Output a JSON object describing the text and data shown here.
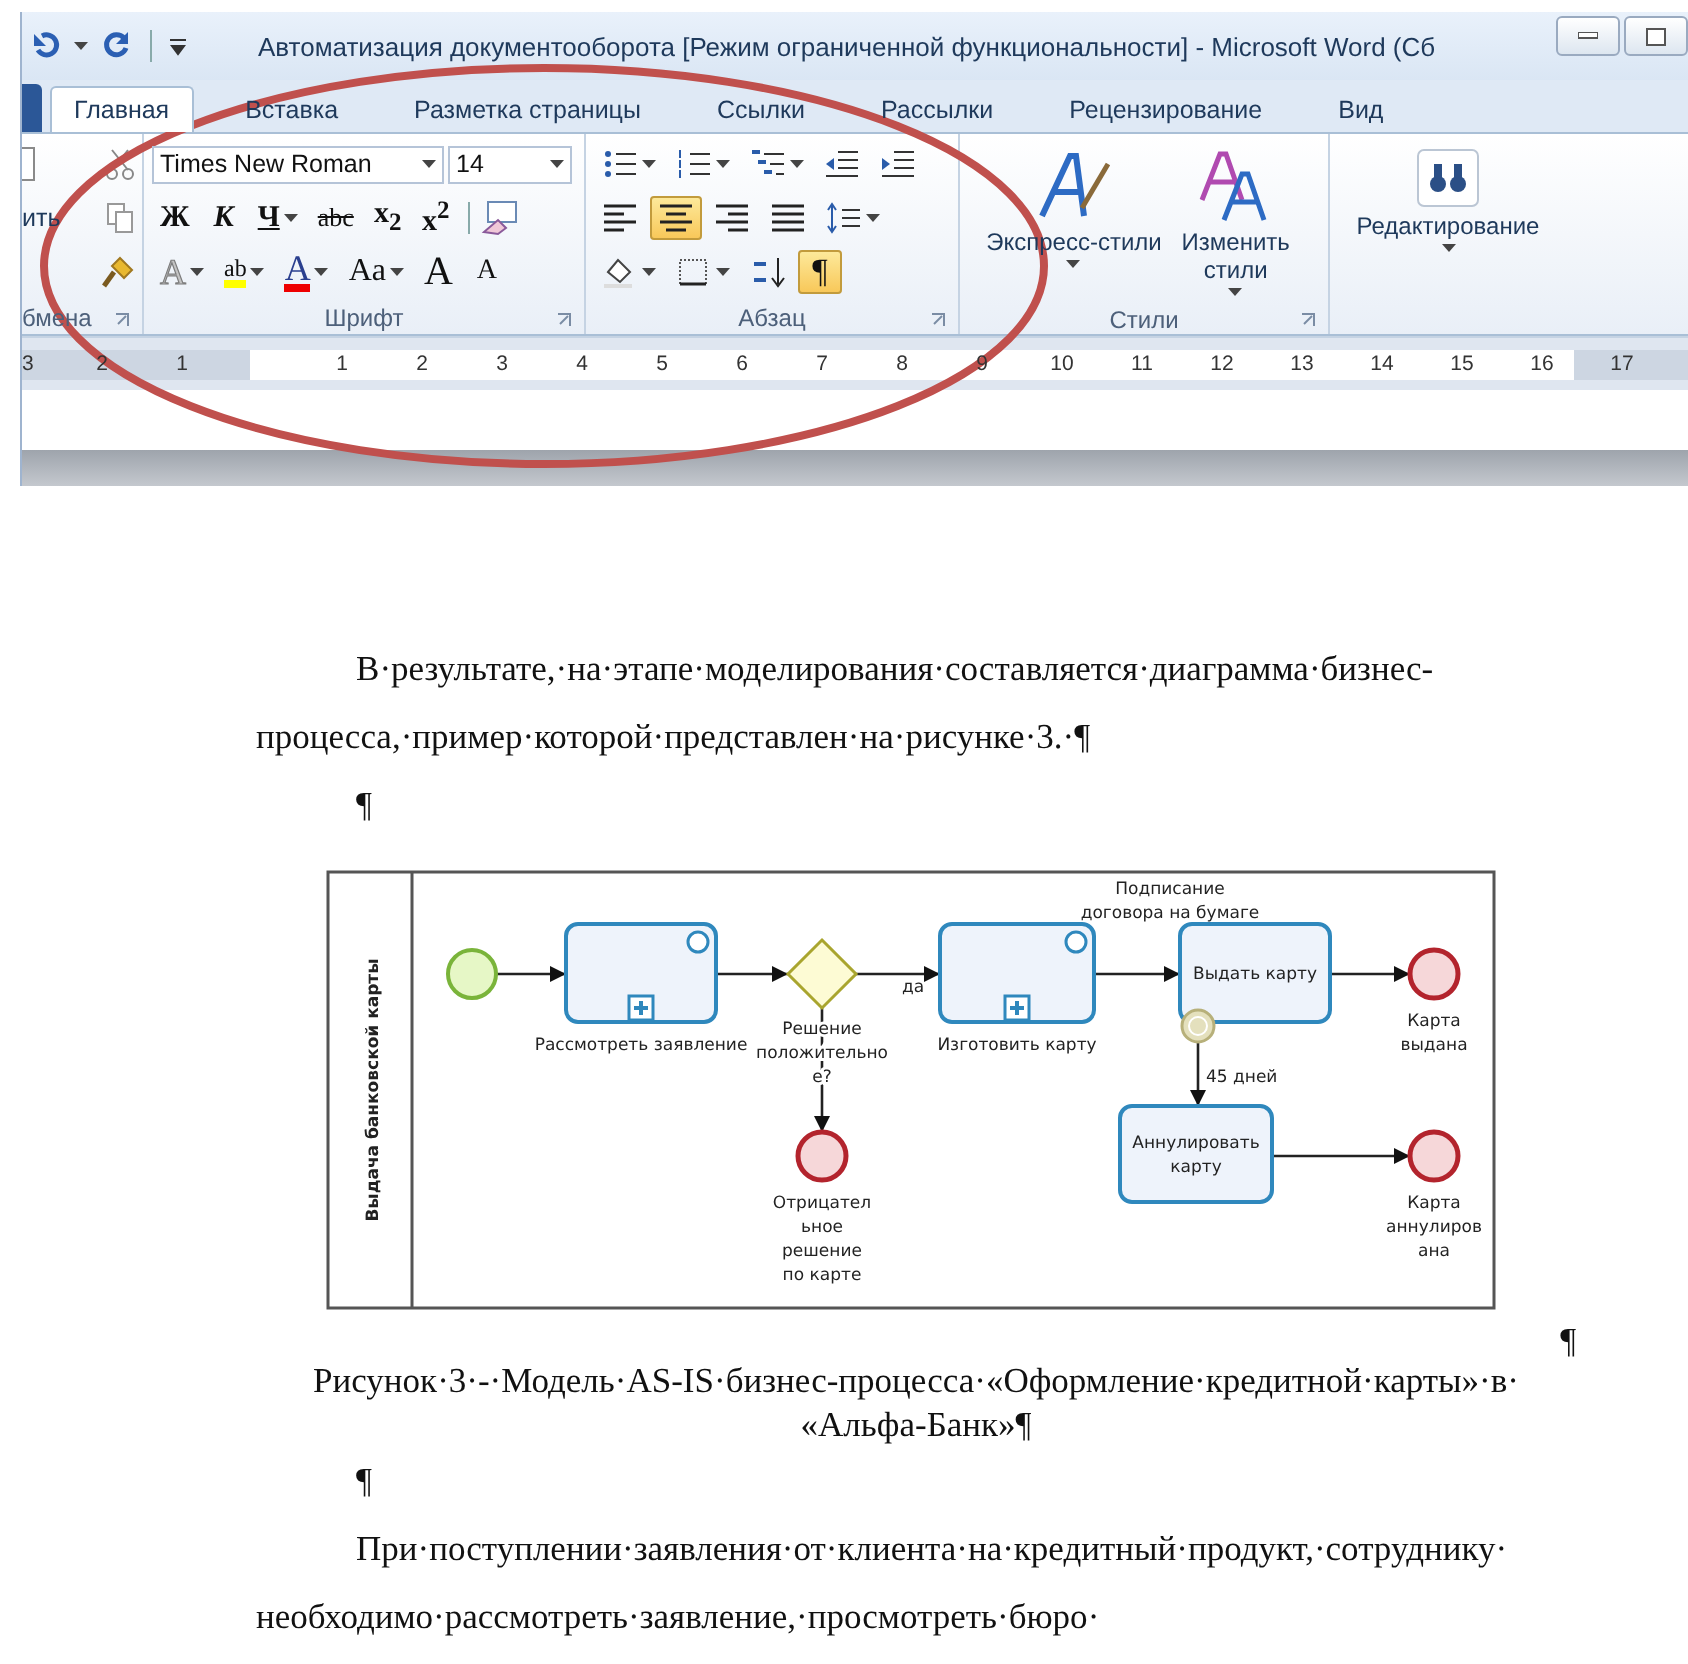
{
  "window": {
    "title": "Автоматизация документооборота [Режим ограниченной функциональности]  -  Microsoft Word (Сб"
  },
  "tabs": [
    {
      "label": "Главная",
      "selected": true
    },
    {
      "label": "Вставка",
      "selected": false
    },
    {
      "label": "Разметка страницы",
      "selected": false
    },
    {
      "label": "Ссылки",
      "selected": false
    },
    {
      "label": "Рассылки",
      "selected": false
    },
    {
      "label": "Рецензирование",
      "selected": false
    },
    {
      "label": "Вид",
      "selected": false
    }
  ],
  "ribbon": {
    "clipboard": {
      "paste_label": "ить",
      "group_label": "бмена"
    },
    "font": {
      "font_name": "Times New Roman",
      "font_size": "14",
      "group_label": "Шрифт",
      "row_1": [
        {
          "kind": "bold",
          "label": "Ж"
        },
        {
          "kind": "italic",
          "label": "К"
        },
        {
          "kind": "underline",
          "label": "Ч"
        },
        {
          "kind": "strike",
          "label": "abc"
        },
        {
          "kind": "sub",
          "label": "x$_{2}$"
        },
        {
          "kind": "sup",
          "label": "x$^{2}$"
        }
      ],
      "row_2": [
        {
          "kind": "effects",
          "label": "A"
        },
        {
          "kind": "highlight",
          "label": "ab"
        },
        {
          "kind": "color",
          "label": "A"
        },
        {
          "kind": "case",
          "label": "Aa"
        },
        {
          "kind": "grow",
          "label": "A"
        },
        {
          "kind": "shrink",
          "label": "A"
        }
      ]
    },
    "paragraph": {
      "group_label": "Абзац",
      "row_1": [
        {
          "kind": "bullets",
          "selected": false
        },
        {
          "kind": "numbering",
          "selected": false
        },
        {
          "kind": "multilevel",
          "selected": false
        },
        {
          "kind": "outdent",
          "selected": false
        },
        {
          "kind": "indent",
          "selected": false
        }
      ],
      "row_2": [
        {
          "kind": "align-left",
          "selected": false
        },
        {
          "kind": "align-center",
          "selected": true
        },
        {
          "kind": "align-right",
          "selected": false
        },
        {
          "kind": "justify",
          "selected": false
        },
        {
          "kind": "spacing",
          "selected": false
        }
      ],
      "row_3": [
        {
          "kind": "shading",
          "selected": false
        },
        {
          "kind": "borders",
          "selected": false
        },
        {
          "kind": "sort",
          "selected": false
        },
        {
          "kind": "pilcrow",
          "selected": true,
          "label": "¶"
        }
      ]
    },
    "styles": {
      "group_label": "Стили",
      "buttons": [
        {
          "kind": "quick",
          "label": "Экспресс-стили"
        },
        {
          "kind": "change",
          "label": "Изменить стили"
        }
      ]
    },
    "editing": {
      "label": "Редактирование"
    }
  },
  "ruler": {
    "left_numbers": [
      "3",
      "2",
      "1"
    ],
    "right_numbers": [
      "1",
      "2",
      "3",
      "4",
      "5",
      "6",
      "7",
      "8",
      "9",
      "10",
      "11",
      "12",
      "13",
      "14",
      "15",
      "16",
      "17"
    ]
  },
  "document": [
    {
      "kind": "paragraph",
      "text": "В·результате,·на·этапе·моделирования·составляется·диаграмма·бизнес-процесса,·пример·которой·представлен·на·рисунке·3.·¶"
    },
    {
      "kind": "mark",
      "text": "¶"
    },
    {
      "kind": "figure"
    },
    {
      "kind": "mark_right",
      "text": "¶"
    },
    {
      "kind": "caption",
      "text": "Рисунок·3·-·Модель·AS-IS·бизнес-процесса·«Оформление·кредитной·карты»·в·«Альфа-Банк»¶"
    },
    {
      "kind": "mark",
      "text": "¶"
    },
    {
      "kind": "paragraph",
      "text": "При·поступлении·заявления·от·клиента·на·кредитный·продукт,·сотруднику·необходимо·рассмотреть·заявление,·просмотреть·бюро·"
    }
  ],
  "diagram": {
    "lane_label": "Выдача банковской карты",
    "nodes": [
      {
        "kind": "start"
      },
      {
        "kind": "subprocess",
        "label": [
          "Рассмотреть заявление"
        ]
      },
      {
        "kind": "gateway",
        "label": [
          "Решение",
          "положительно",
          "е?"
        ]
      },
      {
        "kind": "end",
        "label": [
          "Отрицател",
          "ьное",
          "решение",
          "по карте"
        ]
      },
      {
        "kind": "subprocess",
        "label": [
          "Изготовить карту"
        ]
      },
      {
        "kind": "task",
        "label": [
          "Выдать карту"
        ]
      },
      {
        "kind": "timer"
      },
      {
        "kind": "task",
        "label": [
          "Аннулировать",
          "карту"
        ]
      },
      {
        "kind": "end",
        "label": [
          "Карта",
          "выдана"
        ]
      },
      {
        "kind": "end",
        "label": [
          "Карта",
          "аннулиров",
          "ана"
        ]
      }
    ],
    "annotation": [
      "Подписание",
      "договора на бумаге"
    ],
    "flow_labels": [
      "да",
      "45 дней"
    ]
  }
}
